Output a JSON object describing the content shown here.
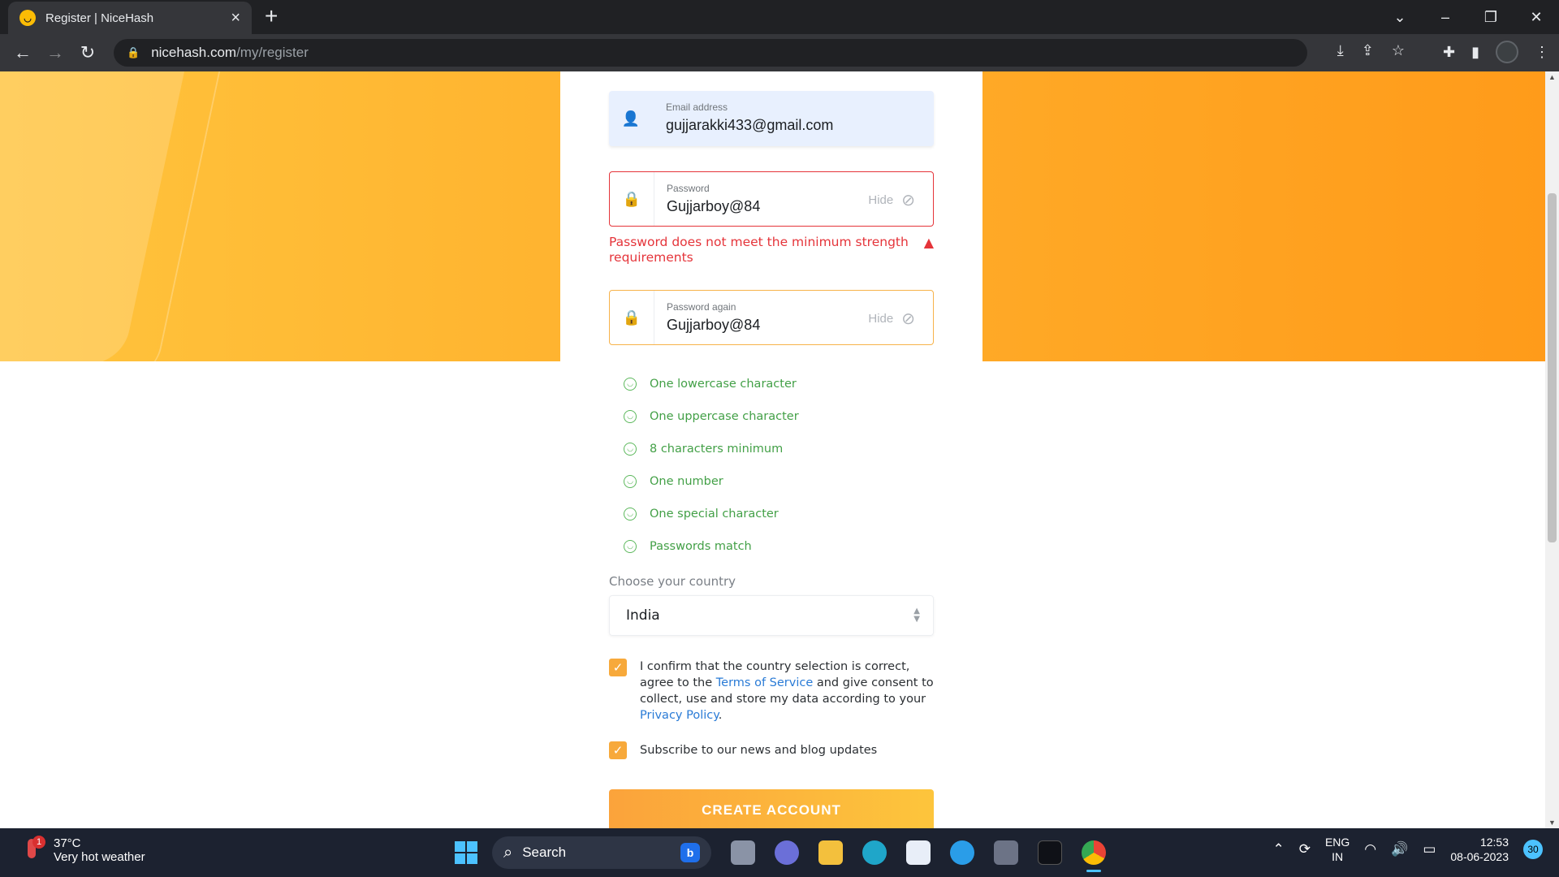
{
  "browser": {
    "tab_title": "Register | NiceHash",
    "url_host": "nicehash.com",
    "url_path": "/my/register"
  },
  "form": {
    "email": {
      "label": "Email address",
      "value": "gujjarakki433@gmail.com"
    },
    "password": {
      "label": "Password",
      "value": "Gujjarboy@84",
      "toggle": "Hide"
    },
    "password_error": "Password does not meet the minimum strength requirements",
    "password_again": {
      "label": "Password again",
      "value": "Gujjarboy@84",
      "toggle": "Hide"
    },
    "requirements": [
      "One lowercase character",
      "One uppercase character",
      "8 characters minimum",
      "One number",
      "One special character",
      "Passwords match"
    ],
    "country_label": "Choose your country",
    "country_value": "India",
    "consent": {
      "text_1": "I confirm that the country selection is correct, agree to the ",
      "terms_link": "Terms of Service",
      "text_2": " and give consent to collect, use and store my data according to your ",
      "privacy_link": "Privacy Policy",
      "text_3": "."
    },
    "subscribe_label": "Subscribe to our news and blog updates",
    "create_button": "CREATE ACCOUNT"
  },
  "taskbar": {
    "weather_temp": "37°C",
    "weather_desc": "Very hot weather",
    "weather_badge": "1",
    "search_label": "Search",
    "lang_1": "ENG",
    "lang_2": "IN",
    "time": "12:53",
    "date": "08-06-2023",
    "notifications": "30"
  },
  "colors": {
    "accent": "#f7a93b",
    "error": "#e5343a",
    "success": "#43a047",
    "link": "#2a7bd6"
  }
}
